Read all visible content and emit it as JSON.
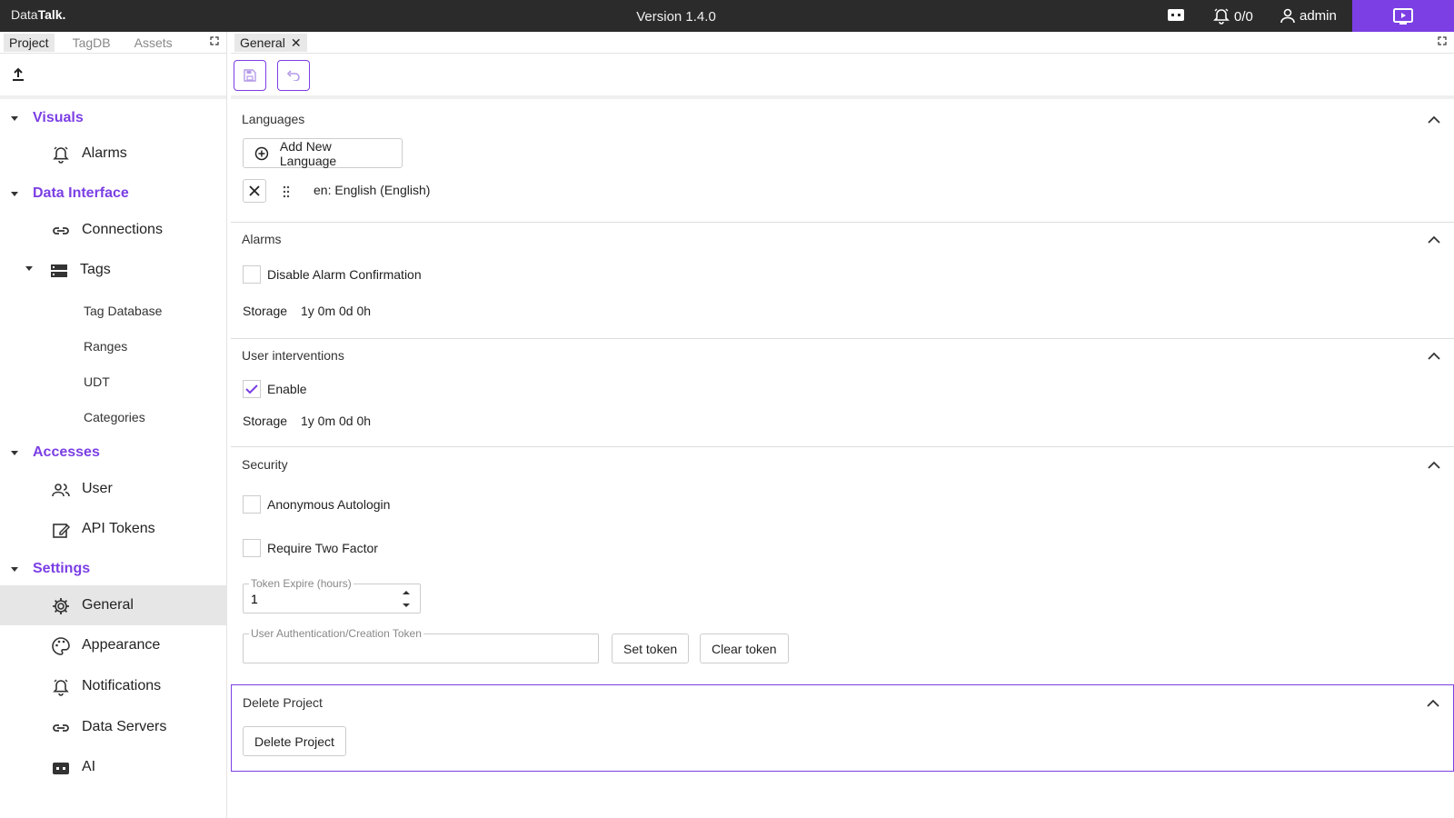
{
  "topbar": {
    "brand_prefix": "Data",
    "brand_suffix": "Talk.",
    "version": "Version 1.4.0",
    "alarm_count": "0/0",
    "username": "admin",
    "accent": "#7b3fe4"
  },
  "left_tabs": [
    "Project",
    "TagDB",
    "Assets"
  ],
  "tree": {
    "visuals": {
      "label": "Visuals",
      "items": [
        "Alarms"
      ]
    },
    "data_interface": {
      "label": "Data Interface",
      "connections": "Connections",
      "tags": "Tags",
      "tag_children": [
        "Tag Database",
        "Ranges",
        "UDT",
        "Categories"
      ]
    },
    "accesses": {
      "label": "Accesses",
      "items": [
        "User",
        "API Tokens"
      ]
    },
    "settings": {
      "label": "Settings",
      "items": [
        "General",
        "Appearance",
        "Notifications",
        "Data Servers",
        "AI"
      ]
    }
  },
  "main_tab": {
    "label": "General",
    "close": "✕"
  },
  "languages": {
    "title": "Languages",
    "add_label": "Add New Language",
    "entry": "en: English (English)"
  },
  "alarms": {
    "title": "Alarms",
    "disable_confirm_label": "Disable Alarm Confirmation",
    "disable_confirm_checked": false,
    "storage_label": "Storage",
    "storage_value": "1y 0m 0d 0h"
  },
  "user_interventions": {
    "title": "User interventions",
    "enable_label": "Enable",
    "enable_checked": true,
    "storage_label": "Storage",
    "storage_value": "1y 0m 0d 0h"
  },
  "security": {
    "title": "Security",
    "anon_label": "Anonymous Autologin",
    "twofactor_label": "Require Two Factor",
    "token_expire_label": "Token Expire (hours)",
    "token_expire_value": "1",
    "auth_token_label": "User Authentication/Creation Token",
    "auth_token_value": "",
    "set_token": "Set token",
    "clear_token": "Clear token"
  },
  "delete_project": {
    "title": "Delete Project",
    "button": "Delete Project"
  }
}
